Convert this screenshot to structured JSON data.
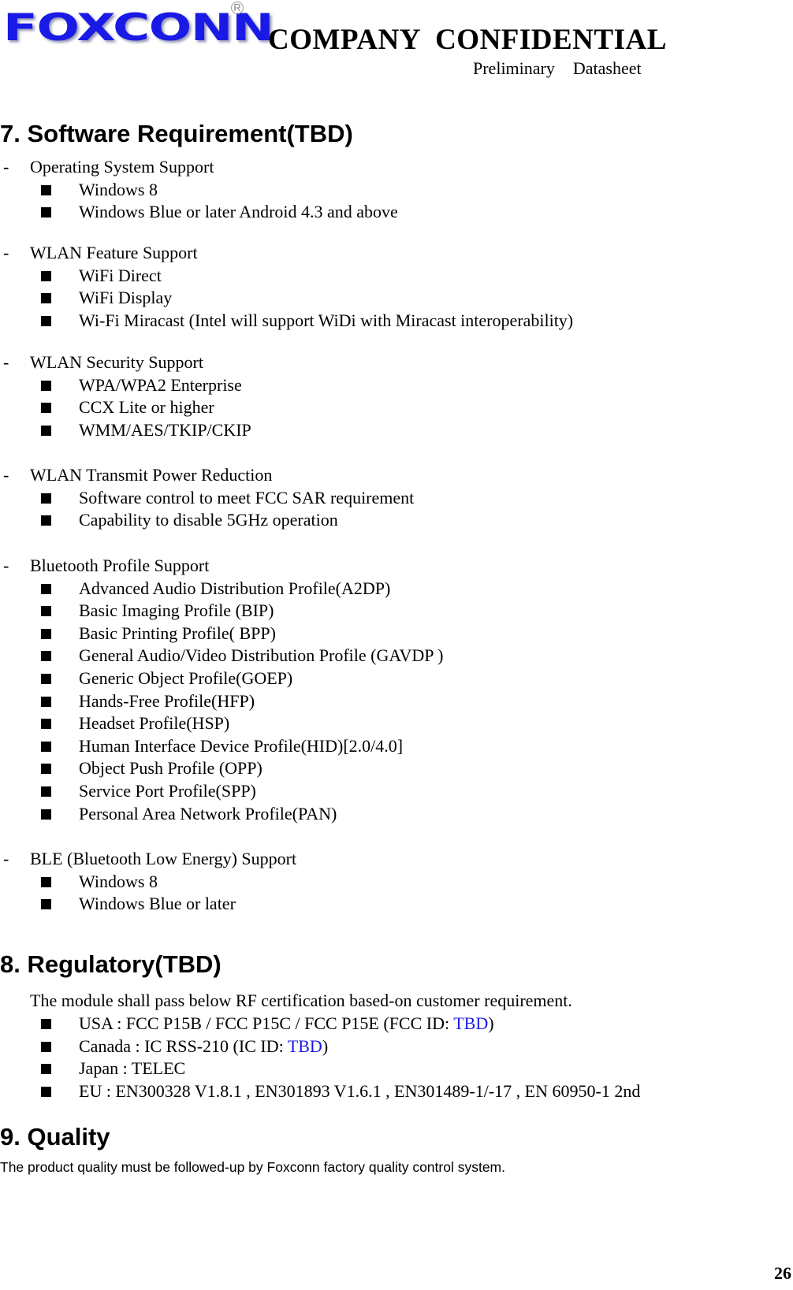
{
  "header": {
    "logo_text": "FOXCONN",
    "logo_registered": "R",
    "confidential": "COMPANY  CONFIDENTIAL",
    "subtitle": "Preliminary  Datasheet",
    "brand_color": "#1a1ae6"
  },
  "section7": {
    "title": "7. Software Requirement(TBD)",
    "groups": [
      {
        "heading": "Operating System Support",
        "items": [
          "Windows 8",
          "Windows Blue or later Android 4.3 and above"
        ]
      },
      {
        "heading": "WLAN Feature Support",
        "items": [
          "WiFi Direct",
          "WiFi Display",
          "Wi-Fi Miracast (Intel will support WiDi with Miracast interoperability)"
        ]
      },
      {
        "heading": "WLAN Security Support",
        "items": [
          "WPA/WPA2 Enterprise",
          "CCX Lite or higher",
          "WMM/AES/TKIP/CKIP"
        ]
      },
      {
        "heading": "WLAN Transmit Power Reduction",
        "items": [
          "Software control to meet FCC SAR requirement",
          "Capability to disable 5GHz operation"
        ]
      },
      {
        "heading": "Bluetooth Profile Support",
        "items": [
          "Advanced Audio Distribution Profile(A2DP)",
          "Basic Imaging Profile (BIP)",
          "Basic Printing Profile( BPP)",
          "General Audio/Video Distribution Profile (GAVDP )",
          "Generic Object Profile(GOEP)",
          "Hands-Free Profile(HFP)",
          "Headset Profile(HSP)",
          "Human Interface Device Profile(HID)[2.0/4.0]",
          "Object Push Profile (OPP)",
          "Service Port Profile(SPP)",
          "Personal Area Network Profile(PAN)"
        ]
      },
      {
        "heading": "BLE (Bluetooth Low Energy) Support",
        "items": [
          "Windows 8",
          "Windows Blue or later"
        ]
      }
    ]
  },
  "section8": {
    "title": "8. Regulatory(TBD)",
    "intro": "The module shall pass below RF certification based-on customer requirement.",
    "items": [
      {
        "prefix": "USA : FCC P15B / FCC P15C / FCC P15E (FCC ID: ",
        "highlight": "TBD",
        "suffix": ")"
      },
      {
        "prefix": "Canada : IC RSS-210 (IC ID: ",
        "highlight": "TBD",
        "suffix": ")"
      },
      {
        "prefix": "Japan : TELEC",
        "highlight": "",
        "suffix": ""
      },
      {
        "prefix": "EU : EN300328 V1.8.1 , EN301893 V1.6.1 , EN301489-1/-17 , EN 60950-1 2nd",
        "highlight": "",
        "suffix": ""
      }
    ],
    "highlight_color": "#1a1ae6"
  },
  "section9": {
    "title": "9. Quality",
    "body": "The product quality must be followed-up by Foxconn factory quality control system."
  },
  "footer": {
    "page_number": "26"
  }
}
